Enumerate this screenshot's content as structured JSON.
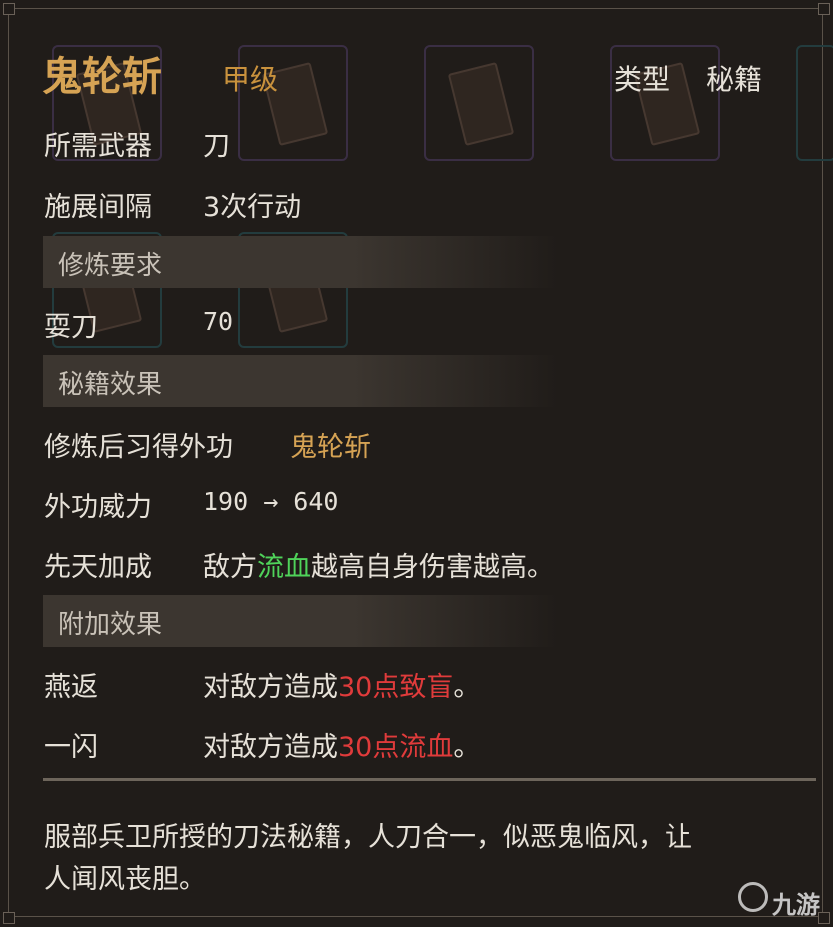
{
  "skill": {
    "name": "鬼轮斩",
    "grade": "甲级",
    "type_label": "类型",
    "type_value": "秘籍"
  },
  "fields": {
    "weapon": {
      "label": "所需武器",
      "value": "刀"
    },
    "interval": {
      "label": "施展间隔",
      "value": "3次行动"
    }
  },
  "sections": {
    "training": "修炼要求",
    "effect": "秘籍效果",
    "extra": "附加效果"
  },
  "training_req": {
    "label": "耍刀",
    "value": "70"
  },
  "effect": {
    "learned": {
      "label": "修炼后习得外功",
      "value": "鬼轮斩"
    },
    "power": {
      "label": "外功威力",
      "value": "190 → 640"
    },
    "innate": {
      "label": "先天加成",
      "prefix": "敌方",
      "highlight": "流血",
      "suffix": "越高自身伤害越高。"
    }
  },
  "extra": [
    {
      "label": "燕返",
      "prefix": "对敌方造成",
      "highlight": "30点致盲",
      "suffix": "。"
    },
    {
      "label": "一闪",
      "prefix": "对敌方造成",
      "highlight": "30点流血",
      "suffix": "。"
    }
  ],
  "description": {
    "line1": "服部兵卫所授的刀法秘籍，人刀合一，似恶鬼临风，让",
    "line2": "人闻风丧胆。"
  },
  "watermark": "九游",
  "colors": {
    "gold": "#d6a354",
    "green": "#4fd35a",
    "red": "#e03b3b",
    "bg": "#201c19"
  }
}
